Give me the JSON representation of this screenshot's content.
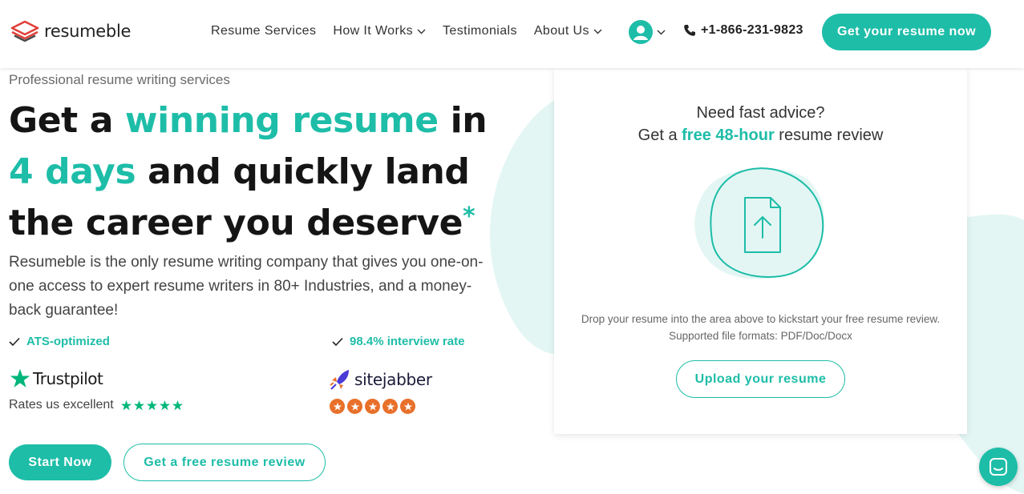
{
  "header": {
    "logo_text": "resumeble",
    "nav": [
      {
        "label": "Resume Services",
        "dropdown": false
      },
      {
        "label": "How It Works",
        "dropdown": true
      },
      {
        "label": "Testimonials",
        "dropdown": false
      },
      {
        "label": "About Us",
        "dropdown": true
      }
    ],
    "phone": "+1-866-231-9823",
    "cta_label": "Get your resume now"
  },
  "hero": {
    "kicker": "Professional resume writing services",
    "headline": {
      "part1": "Get a ",
      "highlight1": "winning resume",
      "part2": " in ",
      "highlight2": "4 days",
      "part3": " and quickly land the career you deserve",
      "asterisk": "*"
    },
    "description": "Resumeble is the only resume writing company that gives you one-on-one access to expert resume writers in 80+ Industries, and a money-back guarantee!",
    "features": [
      "ATS-optimized",
      "98.4% interview rate"
    ],
    "trustpilot": {
      "name": "Trustpilot",
      "rating_text": "Rates us excellent",
      "stars": 5
    },
    "sitejabber": {
      "name": "sitejabber",
      "stars": 5
    },
    "start_label": "Start Now",
    "review_label": "Get a free resume review"
  },
  "card": {
    "line1": "Need fast advice?",
    "line2_pre": "Get a ",
    "line2_highlight": "free 48-hour",
    "line2_post": " resume review",
    "note": "Drop your resume into the area above to kickstart your free resume review. Supported file formats: PDF/Doc/Docx",
    "upload_label": "Upload your resume"
  },
  "colors": {
    "accent": "#1ebda8",
    "accent_light": "#e3f6f4",
    "sitejabber_orange": "#e8702a",
    "trustpilot_green": "#00b67a"
  },
  "icons": [
    "logo-stack-icon",
    "chevron-down-icon",
    "user-avatar-icon",
    "phone-icon",
    "check-icon",
    "trustpilot-star-icon",
    "sitejabber-logo-icon",
    "file-upload-icon",
    "chat-icon"
  ]
}
